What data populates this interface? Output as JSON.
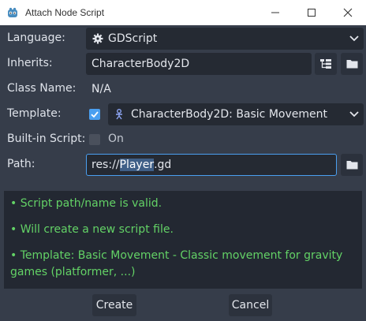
{
  "window": {
    "title": "Attach Node Script"
  },
  "form": {
    "language_label": "Language:",
    "language_value": "GDScript",
    "inherits_label": "Inherits:",
    "inherits_value": "CharacterBody2D",
    "classname_label": "Class Name:",
    "classname_value": "N/A",
    "template_label": "Template:",
    "template_checked": true,
    "template_value": "CharacterBody2D: Basic Movement",
    "builtin_label": "Built-in Script:",
    "builtin_checked": false,
    "builtin_state": "On",
    "path_label": "Path:",
    "path_prefix": "res://",
    "path_selected": "Player",
    "path_suffix": ".gd"
  },
  "messages": [
    "•  Script path/name is valid.",
    "•  Will create a new script file.",
    "•  Template: Basic Movement - Classic movement for gravity",
    "games (platformer, ...)"
  ],
  "buttons": {
    "create": "Create",
    "cancel": "Cancel"
  },
  "colors": {
    "background": "#363d4a",
    "field": "#252a33",
    "accent": "#4a9ff0",
    "success_text": "#63d266"
  },
  "icons": {
    "app": "godot-icon",
    "language": "gear-icon",
    "template": "character-node-icon",
    "tree": "node-tree-icon",
    "folder": "folder-icon"
  }
}
